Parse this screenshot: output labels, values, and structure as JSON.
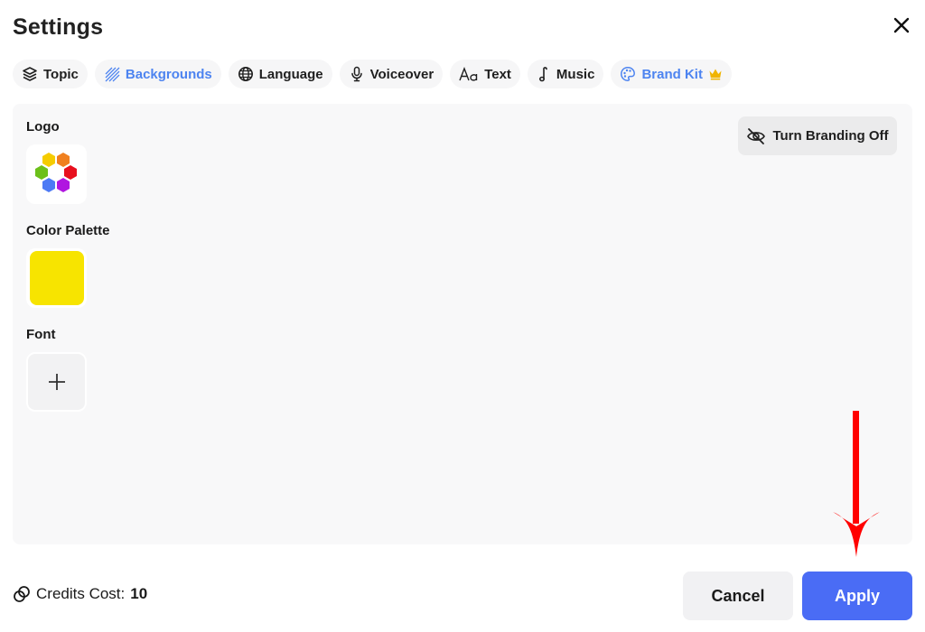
{
  "dialog": {
    "title": "Settings",
    "close_icon": "close-icon"
  },
  "tabs": [
    {
      "label": "Topic",
      "icon": "layers-icon",
      "active": false
    },
    {
      "label": "Backgrounds",
      "icon": "hatch-pattern-icon",
      "active": true
    },
    {
      "label": "Language",
      "icon": "globe-icon",
      "active": false
    },
    {
      "label": "Voiceover",
      "icon": "microphone-icon",
      "active": false
    },
    {
      "label": "Text",
      "icon": "text-aa-icon",
      "active": false
    },
    {
      "label": "Music",
      "icon": "music-note-icon",
      "active": false
    },
    {
      "label": "Brand Kit",
      "icon": "palette-icon",
      "badge_icon": "crown-icon",
      "active": false
    }
  ],
  "brand_kit": {
    "logo_label": "Logo",
    "logo_icon": "hexagon-flower-logo",
    "color_palette_label": "Color Palette",
    "palette_colors": [
      "#f7e400"
    ],
    "font_label": "Font",
    "font_add_icon": "plus-icon",
    "branding_toggle_label": "Turn Branding Off",
    "branding_toggle_icon": "eye-off-icon"
  },
  "footer": {
    "credits_label": "Credits Cost:",
    "credits_value": "10",
    "credits_icon": "coins-icon",
    "cancel_label": "Cancel",
    "apply_label": "Apply"
  },
  "colors": {
    "accent_blue": "#4d84f0",
    "apply_button": "#4a6cf5",
    "crown": "#f0b400",
    "annotation_arrow": "#ff0000"
  }
}
